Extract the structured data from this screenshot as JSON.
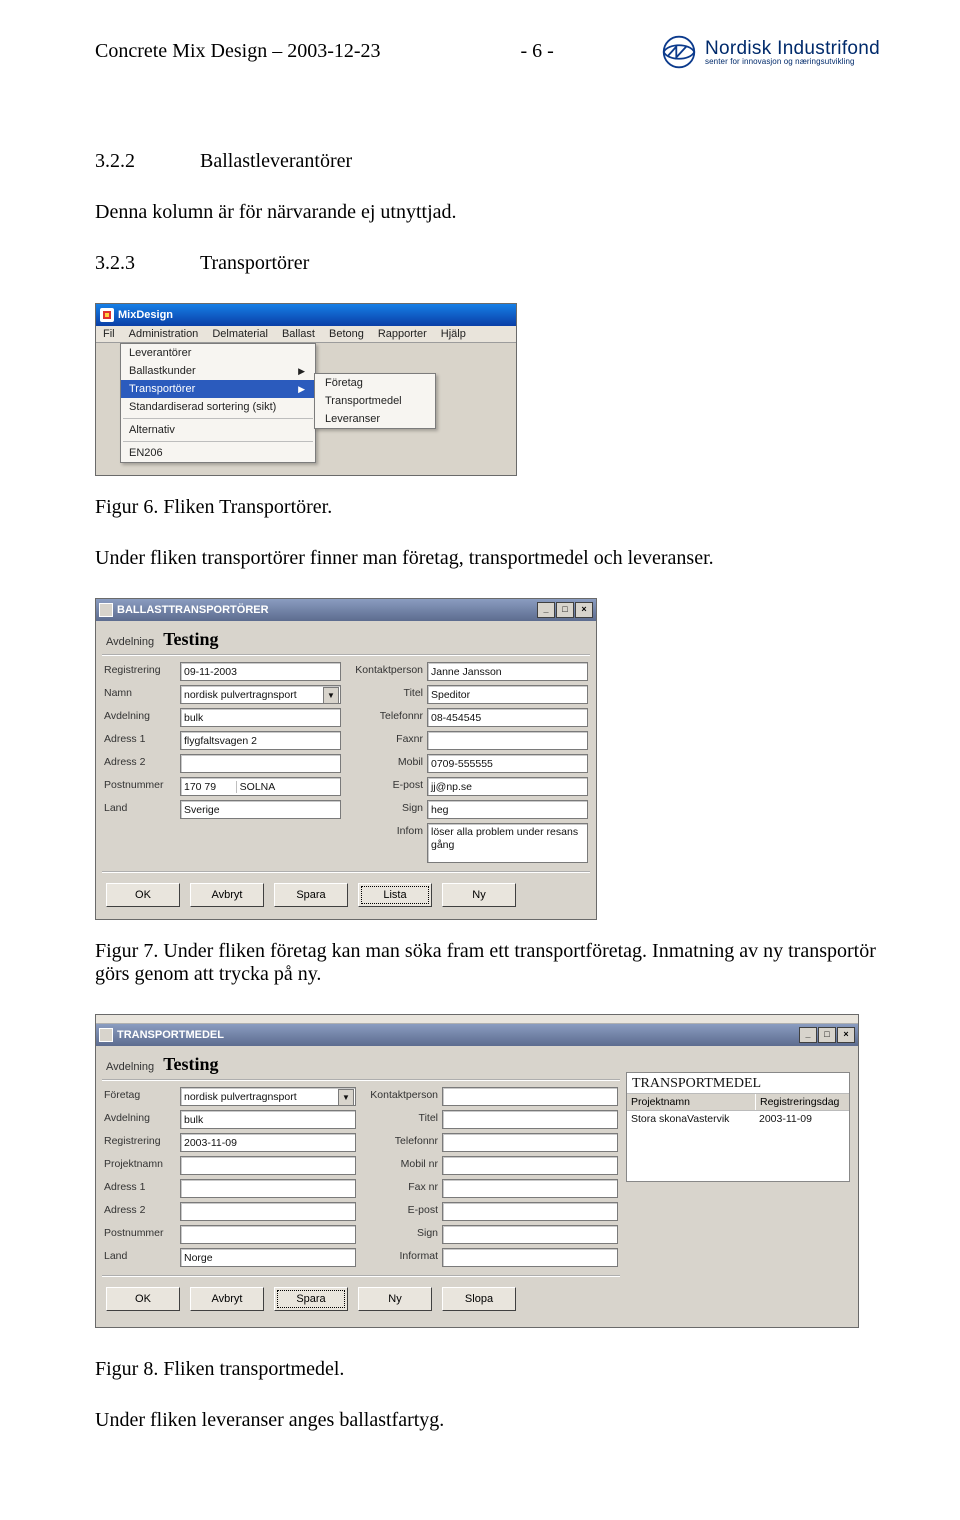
{
  "header": {
    "title": "Concrete Mix Design – 2003-12-23",
    "page_no": "- 6 -",
    "logo_main": "Nordisk Industrifond",
    "logo_sub": "senter for innovasjon og næringsutvikling"
  },
  "s1": {
    "num": "3.2.2",
    "title": "Ballastleverantörer",
    "body": "Denna kolumn är för närvarande ej utnyttjad."
  },
  "s2": {
    "num": "3.2.3",
    "title": "Transportörer"
  },
  "fig6": {
    "app_title": "MixDesign",
    "menubar": [
      "Fil",
      "Administration",
      "Delmaterial",
      "Ballast",
      "Betong",
      "Rapporter",
      "Hjälp"
    ],
    "menu1": {
      "items": [
        "Leverantörer",
        "Ballastkunder",
        "Transportörer",
        "Standardiserad sortering (sikt)"
      ],
      "after_sep": [
        "Alternativ"
      ],
      "after_sep2": [
        "EN206"
      ],
      "highlight": 2
    },
    "menu2": [
      "Företag",
      "Transportmedel",
      "Leveranser"
    ]
  },
  "fig6_caption": "Figur 6. Fliken Transportörer.",
  "fig6_after": "Under fliken transportörer finner man företag, transportmedel och leveranser.",
  "fig7": {
    "title": "BALLASTTRANSPORTÖRER",
    "avd_label": "Avdelning",
    "avd_value": "Testing",
    "left": {
      "registrering_l": "Registrering",
      "registrering_v": "09-11-2003",
      "namn_l": "Namn",
      "namn_v": "nordisk pulvertragnsport",
      "avdelning_l": "Avdelning",
      "avdelning_v": "bulk",
      "adress1_l": "Adress 1",
      "adress1_v": "flygfaltsvagen 2",
      "adress2_l": "Adress 2",
      "adress2_v": "",
      "postnr_l": "Postnummer",
      "postnr_a": "170 79",
      "postnr_b": "SOLNA",
      "land_l": "Land",
      "land_v": "Sverige"
    },
    "right": {
      "kontakt_l": "Kontaktperson",
      "kontakt_v": "Janne Jansson",
      "titel_l": "Titel",
      "titel_v": "Speditor",
      "telefon_l": "Telefonnr",
      "telefon_v": "08-454545",
      "fax_l": "Faxnr",
      "fax_v": "",
      "mobil_l": "Mobil",
      "mobil_v": "0709-555555",
      "epost_l": "E-post",
      "epost_v": "jj@np.se",
      "sign_l": "Sign",
      "sign_v": "heg",
      "infom_l": "Infom",
      "infom_v": "löser alla problem under resans gång"
    },
    "buttons": [
      "OK",
      "Avbryt",
      "Spara",
      "Lista",
      "Ny"
    ]
  },
  "fig7_caption": "Figur 7. Under fliken företag kan man söka fram ett transportföretag. Inmatning av ny transportör görs genom att trycka på ny.",
  "fig8": {
    "title": "TRANSPORTMEDEL",
    "avd_label": "Avdelning",
    "avd_value": "Testing",
    "left": {
      "foretag_l": "Företag",
      "foretag_v": "nordisk pulvertragnsport",
      "avdelning_l": "Avdelning",
      "avdelning_v": "bulk",
      "registrering_l": "Registrering",
      "registrering_v": "2003-11-09",
      "projekt_l": "Projektnamn",
      "projekt_v": "",
      "adress1_l": "Adress 1",
      "adress1_v": "",
      "adress2_l": "Adress 2",
      "adress2_v": "",
      "postnr_l": "Postnummer",
      "postnr_a": "",
      "postnr_b": "",
      "land_l": "Land",
      "land_v": "Norge"
    },
    "right": {
      "kontakt_l": "Kontaktperson",
      "titel_l": "Titel",
      "telefon_l": "Telefonnr",
      "mobil_l": "Mobil nr",
      "fax_l": "Fax nr",
      "epost_l": "E-post",
      "sign_l": "Sign",
      "informat_l": "Informat"
    },
    "buttons": [
      "OK",
      "Avbryt",
      "Spara",
      "Ny",
      "Slopa"
    ],
    "listbox": {
      "title": "TRANSPORTMEDEL",
      "col1": "Projektnamn",
      "col2": "Registreringsdag",
      "row1_c1": "Stora skonaVastervik",
      "row1_c2": "2003-11-09"
    }
  },
  "fig8_caption": "Figur 8. Fliken transportmedel.",
  "closing": "Under fliken leveranser anges ballastfartyg."
}
